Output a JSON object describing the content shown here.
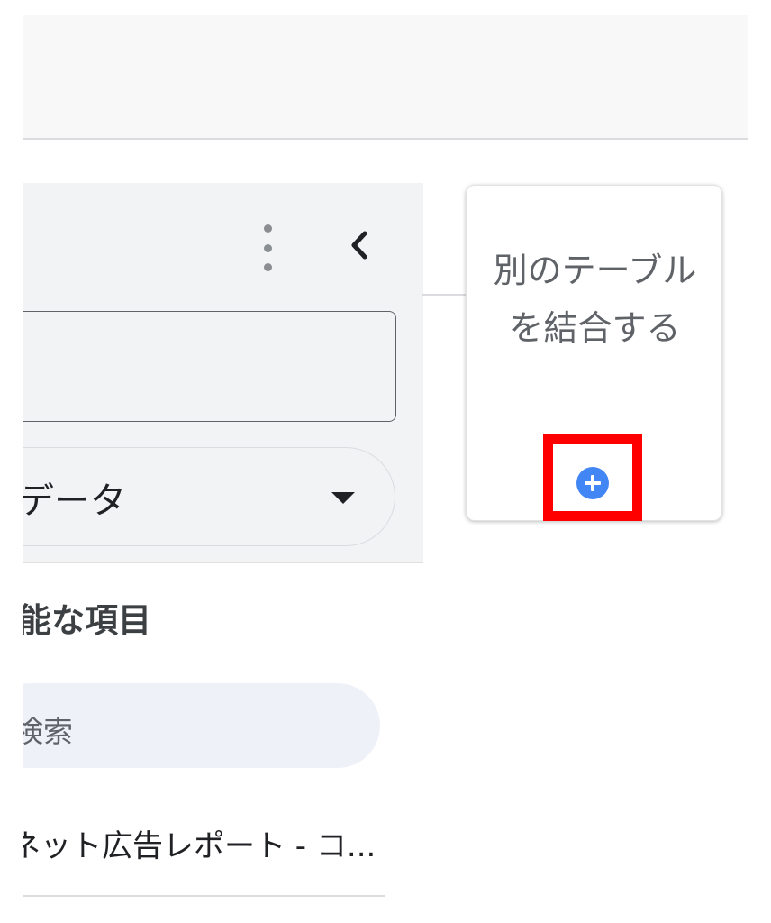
{
  "toolbar": {},
  "panel": {
    "source_label": "データ",
    "section_title": "能な項目",
    "search": {
      "placeholder": "検索"
    },
    "fields": [
      {
        "label": "ネット広告レポート - コ..."
      }
    ]
  },
  "join": {
    "label": "別のテーブルを結合する"
  },
  "colors": {
    "accent": "#4285f4",
    "highlight": "#ff0000",
    "panel_bg": "#f1f3f4"
  }
}
